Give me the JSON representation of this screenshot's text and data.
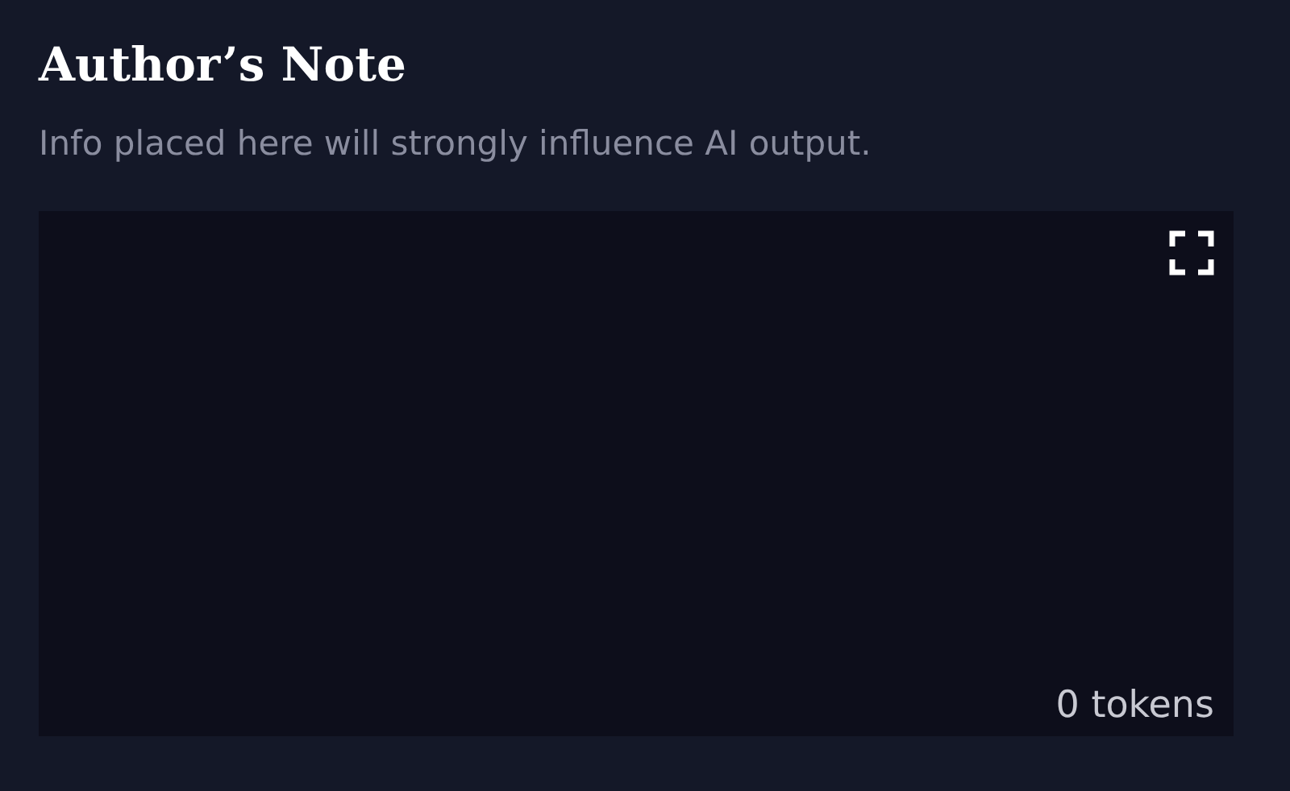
{
  "title": "Author’s Note",
  "description": "Info placed here will strongly influence AI output.",
  "editor": {
    "token_count": "0 tokens"
  }
}
